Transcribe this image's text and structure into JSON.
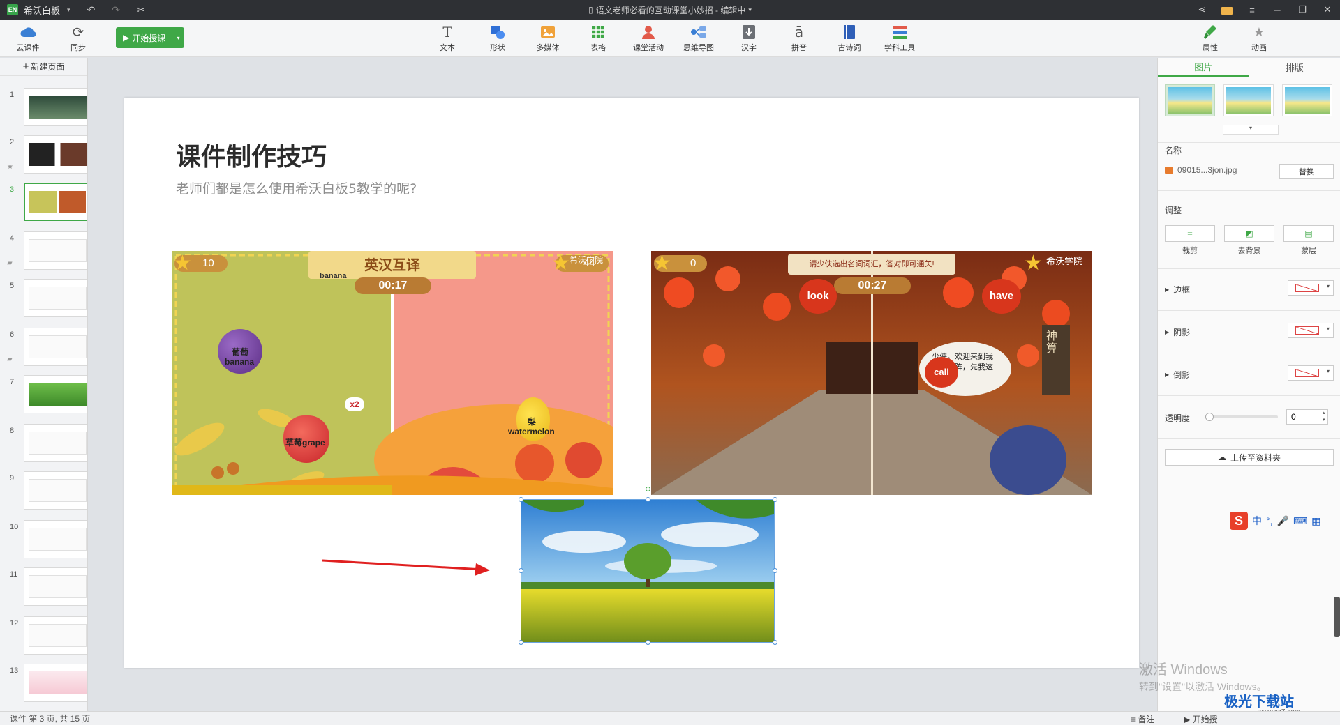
{
  "titlebar": {
    "logo": "EN",
    "app_name": "希沃白板",
    "document_title": "语文老师必看的互动课堂小妙招 - 编辑中",
    "icons": [
      "undo-icon",
      "redo-icon",
      "cut-icon",
      "share-icon",
      "mail-icon",
      "minimize-icon",
      "restore-icon",
      "close-icon"
    ]
  },
  "toolbar": {
    "cloud_label": "云课件",
    "sync_label": "同步",
    "start_label": "开始授课",
    "tools": [
      {
        "label": "文本",
        "icon": "text-icon"
      },
      {
        "label": "形状",
        "icon": "shape-icon"
      },
      {
        "label": "多媒体",
        "icon": "media-icon"
      },
      {
        "label": "表格",
        "icon": "table-icon"
      },
      {
        "label": "课堂活动",
        "icon": "activity-icon"
      },
      {
        "label": "思维导图",
        "icon": "mindmap-icon"
      },
      {
        "label": "汉字",
        "icon": "hanzi-icon"
      },
      {
        "label": "拼音",
        "icon": "pinyin-icon"
      },
      {
        "label": "古诗词",
        "icon": "poetry-icon"
      },
      {
        "label": "学科工具",
        "icon": "subject-tools-icon"
      }
    ],
    "right_tabs": [
      {
        "label": "属性",
        "icon": "brush-icon",
        "active": true
      },
      {
        "label": "动画",
        "icon": "star-icon",
        "active": false
      }
    ]
  },
  "left_panel": {
    "new_page_label": "新建页面",
    "pages": [
      "1",
      "2",
      "3",
      "4",
      "5",
      "6",
      "7",
      "8",
      "9",
      "10",
      "11",
      "12",
      "13"
    ],
    "active_page": "3"
  },
  "slide": {
    "title": "课件制作技巧",
    "subtitle": "老师们都是怎么使用希沃白板5教学的呢?",
    "game1": {
      "banner": "英汉互译",
      "score_left": "10",
      "score_right": "44",
      "timer": "00:17",
      "word_banana": "banana",
      "grape_cn": "葡萄",
      "grape_en": "banana",
      "strawberry": "草莓grape",
      "multiplier": "x2",
      "pear_cn": "梨",
      "pear_en": "watermelon",
      "watermark": "希沃学院"
    },
    "game2": {
      "banner": "请少侠选出名词词汇，答对即可通关!",
      "score": "0",
      "timer": "00:27",
      "word_look": "look",
      "word_have": "have",
      "word_call": "call",
      "speech": "少侠，欢迎来到我的孔明阵，先我这关吧!",
      "sign": "神算",
      "watermark": "希沃学院"
    }
  },
  "right_panel": {
    "tabs": [
      "图片",
      "排版"
    ],
    "active_tab": "图片",
    "name_label": "名称",
    "file_name": "09015...3jon.jpg",
    "replace_label": "替换",
    "adjust_label": "调整",
    "adjust_buttons": [
      "裁剪",
      "去背景",
      "蒙层"
    ],
    "border_label": "边框",
    "shadow_label": "阴影",
    "reflection_label": "倒影",
    "opacity_label": "透明度",
    "opacity_value": "0",
    "upload_label": "上传至资料夹"
  },
  "ime": {
    "lang": "中"
  },
  "watermark": {
    "line1": "激活 Windows",
    "line2": "转到\"设置\"以激活 Windows。"
  },
  "site_watermark": {
    "name": "极光下载站",
    "url": "www.xz7.com"
  },
  "statusbar": {
    "page_info": "课件 第 3 页, 共 15 页",
    "notes_label": "备注",
    "start_label": "开始授"
  },
  "colors": {
    "accent": "#3fa847",
    "titlebar": "#2e3034"
  }
}
